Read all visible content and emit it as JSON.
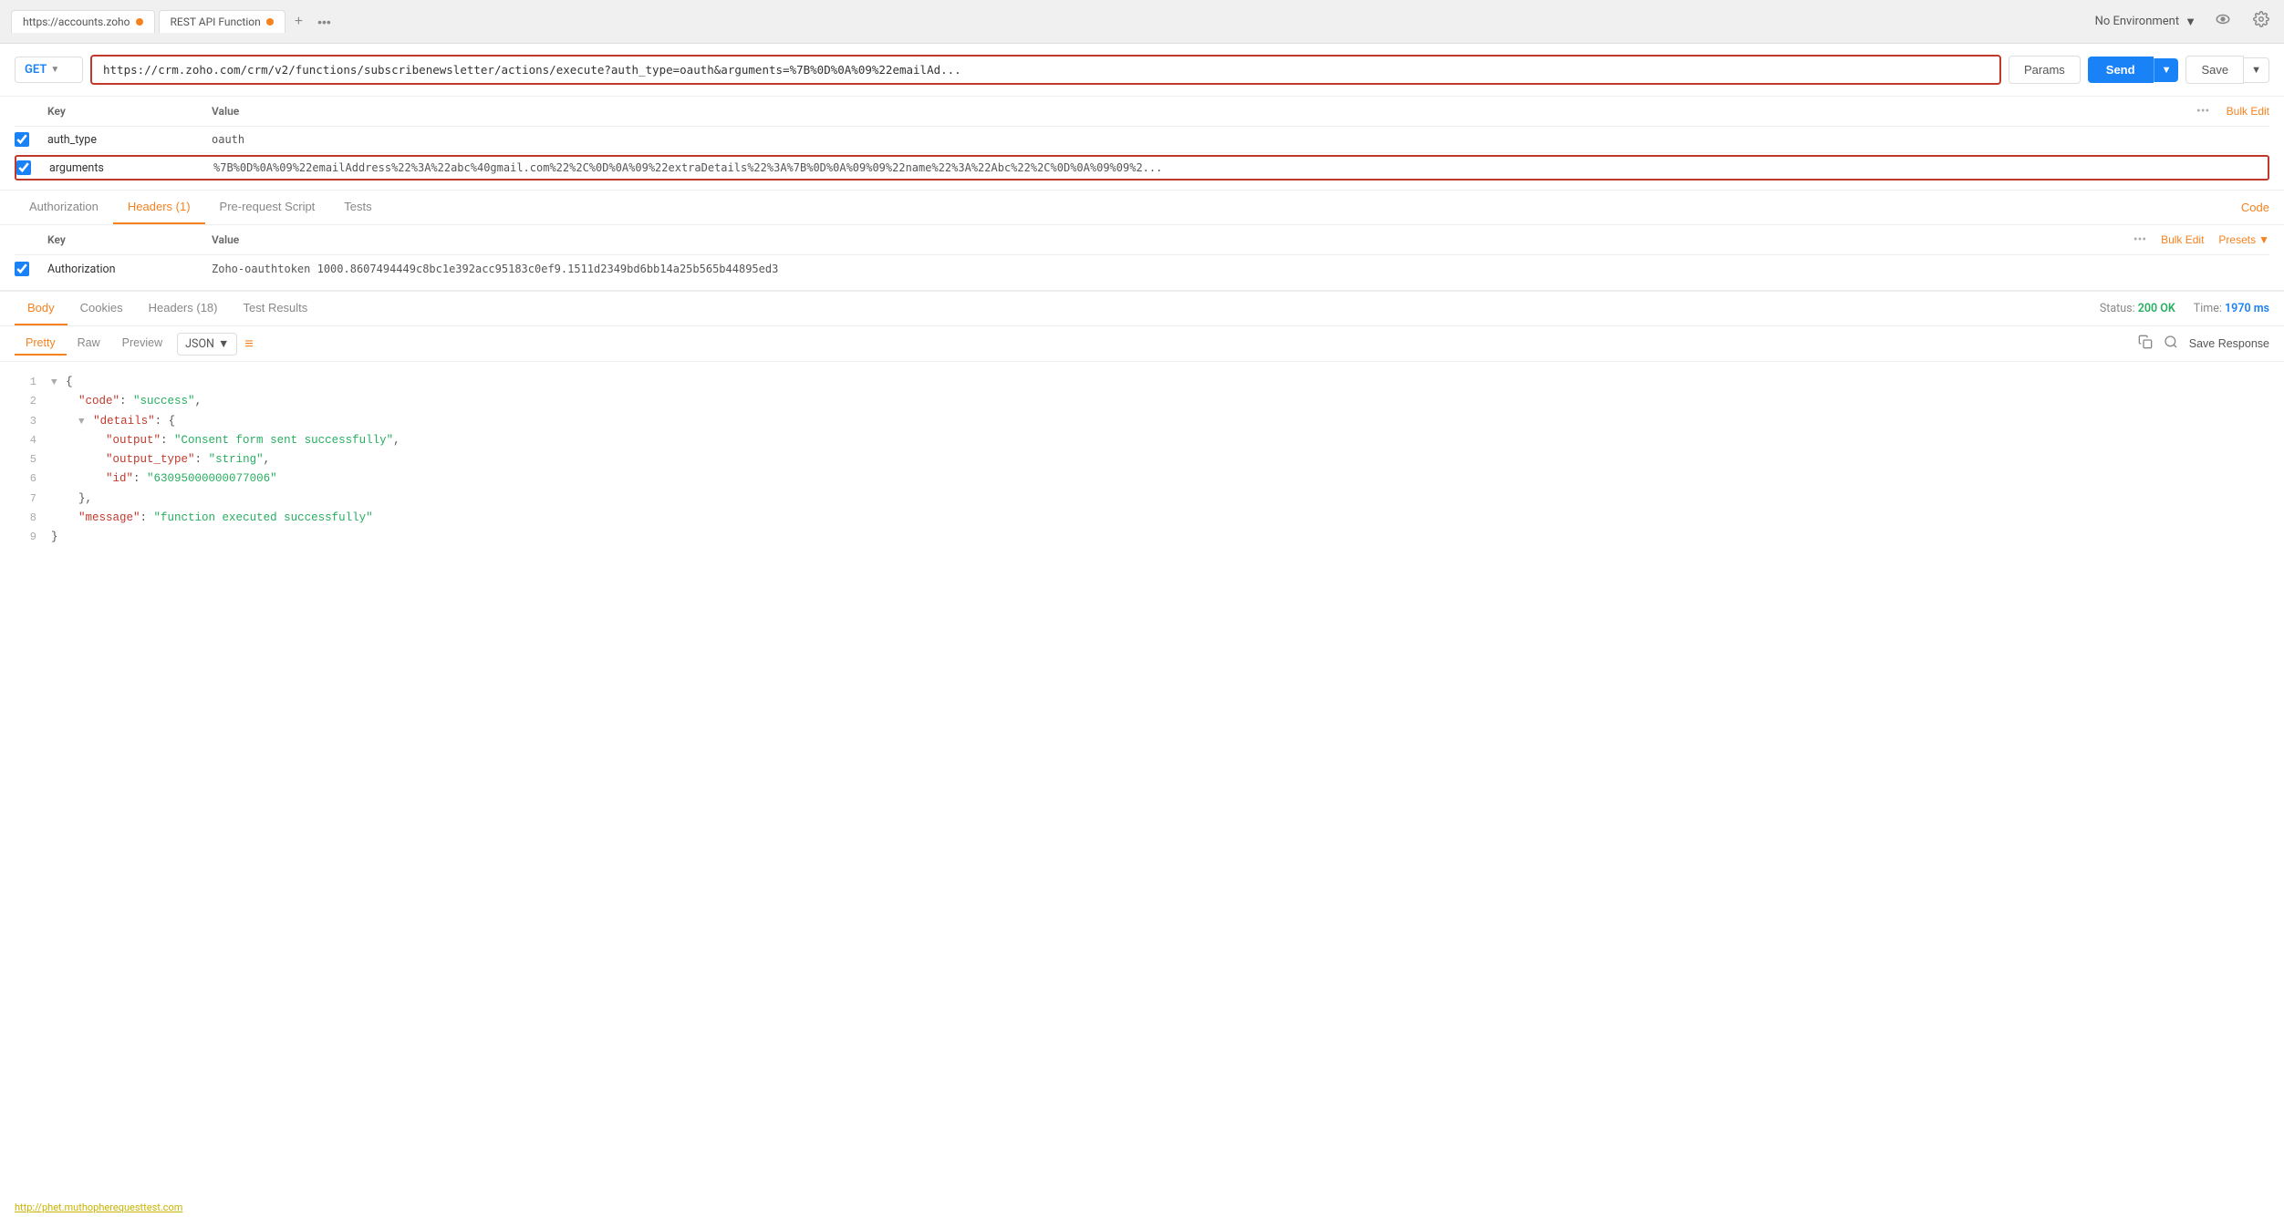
{
  "tabs": {
    "items": [
      {
        "label": "https://accounts.zoho",
        "dot": true,
        "dot_color": "#f5821f"
      },
      {
        "label": "REST API Function",
        "dot": true,
        "dot_color": "#f5821f"
      }
    ],
    "add_label": "+",
    "more_label": "•••"
  },
  "env_selector": {
    "label": "No Environment",
    "chevron": "▼"
  },
  "url_bar": {
    "method": "GET",
    "url": "https://crm.zoho.com/crm/v2/functions/subscribenewsletter/actions/execute?auth_type=oauth&arguments=%7B%0D%0A%09%22emailAd...",
    "params_label": "Params",
    "send_label": "Send",
    "save_label": "Save"
  },
  "params_table": {
    "headers": {
      "key": "Key",
      "value": "Value",
      "bulk_edit": "Bulk Edit"
    },
    "rows": [
      {
        "checked": true,
        "key": "auth_type",
        "value": "oauth"
      },
      {
        "checked": true,
        "key": "arguments",
        "value": "%7B%0D%0A%09%22emailAddress%22%3A%22abc%40gmail.com%22%2C%0D%0A%09%22extraDetails%22%3A%7B%0D%0A%09%09%22name%22%3A%22Abc%22%2C%0D%0A%09%09%2..."
      }
    ]
  },
  "request_tabs": {
    "items": [
      {
        "label": "Authorization",
        "active": false
      },
      {
        "label": "Headers (1)",
        "active": true
      },
      {
        "label": "Pre-request Script",
        "active": false
      },
      {
        "label": "Tests",
        "active": false
      }
    ],
    "code_label": "Code"
  },
  "headers_table": {
    "headers": {
      "key": "Key",
      "value": "Value",
      "bulk_edit": "Bulk Edit",
      "presets": "Presets"
    },
    "rows": [
      {
        "checked": true,
        "key": "Authorization",
        "value": "Zoho-oauthtoken 1000.8607494449c8bc1e392acc95183c0ef9.1511d2349bd6bb14a25b565b44895ed3"
      }
    ]
  },
  "response_tabs": {
    "items": [
      {
        "label": "Body",
        "active": true
      },
      {
        "label": "Cookies",
        "active": false
      },
      {
        "label": "Headers (18)",
        "active": false
      },
      {
        "label": "Test Results",
        "active": false
      }
    ],
    "status_label": "Status:",
    "status_value": "200 OK",
    "time_label": "Time:",
    "time_value": "1970 ms"
  },
  "format_bar": {
    "tabs": [
      {
        "label": "Pretty",
        "active": true
      },
      {
        "label": "Raw",
        "active": false
      },
      {
        "label": "Preview",
        "active": false
      }
    ],
    "format_select": "JSON",
    "save_response_label": "Save Response"
  },
  "json_output": {
    "lines": [
      {
        "num": "1",
        "content": "{",
        "type": "brace",
        "collapse": true
      },
      {
        "num": "2",
        "content": "    \"code\": \"success\",",
        "type": "keyval"
      },
      {
        "num": "3",
        "content": "    \"details\": {",
        "type": "keyval",
        "collapse": true
      },
      {
        "num": "4",
        "content": "        \"output\": \"Consent form sent successfully\",",
        "type": "keyval"
      },
      {
        "num": "5",
        "content": "        \"output_type\": \"string\",",
        "type": "keyval"
      },
      {
        "num": "6",
        "content": "        \"id\": \"63095000000077006\"",
        "type": "keyval"
      },
      {
        "num": "7",
        "content": "    },",
        "type": "brace"
      },
      {
        "num": "8",
        "content": "    \"message\": \"function executed successfully\"",
        "type": "keyval"
      },
      {
        "num": "9",
        "content": "}",
        "type": "brace"
      }
    ]
  },
  "bottom_link": {
    "text": "http://phet.muthopherequesttest.com"
  }
}
